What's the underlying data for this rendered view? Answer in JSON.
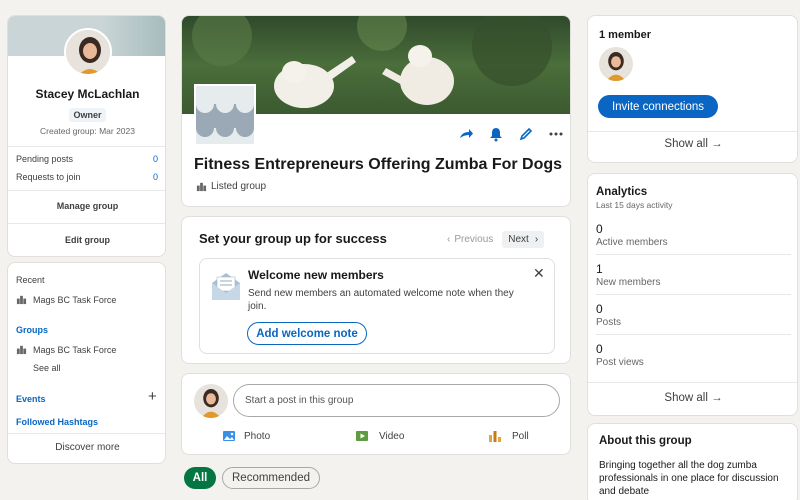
{
  "profile": {
    "name": "Stacey McLachlan",
    "role": "Owner",
    "created": "Created group: Mar 2023",
    "stats": [
      {
        "label": "Pending posts",
        "value": "0"
      },
      {
        "label": "Requests to join",
        "value": "0"
      }
    ],
    "manage_label": "Manage group",
    "edit_label": "Edit group"
  },
  "nav": {
    "recent_title": "Recent",
    "recent_item": "Mags BC Task Force",
    "groups_title": "Groups",
    "groups_item": "Mags BC Task Force",
    "see_all": "See all",
    "events": "Events",
    "hashtags": "Followed Hashtags",
    "discover": "Discover more"
  },
  "group": {
    "title": "Fitness Entrepreneurs Offering Zumba For Dogs",
    "type": "Listed group"
  },
  "setup": {
    "title": "Set your group up for success",
    "previous": "Previous",
    "next": "Next",
    "welcome_title": "Welcome new members",
    "welcome_desc": "Send new members an automated welcome note when they join.",
    "welcome_button": "Add welcome note"
  },
  "post": {
    "placeholder": "Start a post in this group",
    "photo": "Photo",
    "video": "Video",
    "poll": "Poll"
  },
  "filters": {
    "all": "All",
    "recommended": "Recommended"
  },
  "members": {
    "count": "1 member",
    "invite": "Invite connections",
    "show_all": "Show all →"
  },
  "analytics": {
    "title": "Analytics",
    "subtitle": "Last 15 days activity",
    "items": [
      {
        "value": "0",
        "label": "Active members"
      },
      {
        "value": "1",
        "label": "New members"
      },
      {
        "value": "0",
        "label": "Posts"
      },
      {
        "value": "0",
        "label": "Post views"
      }
    ],
    "show_all": "Show all →"
  },
  "about": {
    "title": "About this group",
    "text": "Bringing together all the dog zumba professionals in one place for discussion and debate"
  },
  "colors": {
    "brand": "#0a66c2",
    "video_green": "#5f9b41",
    "poll_orange": "#e7a33e",
    "photo_blue": "#378fe9"
  }
}
